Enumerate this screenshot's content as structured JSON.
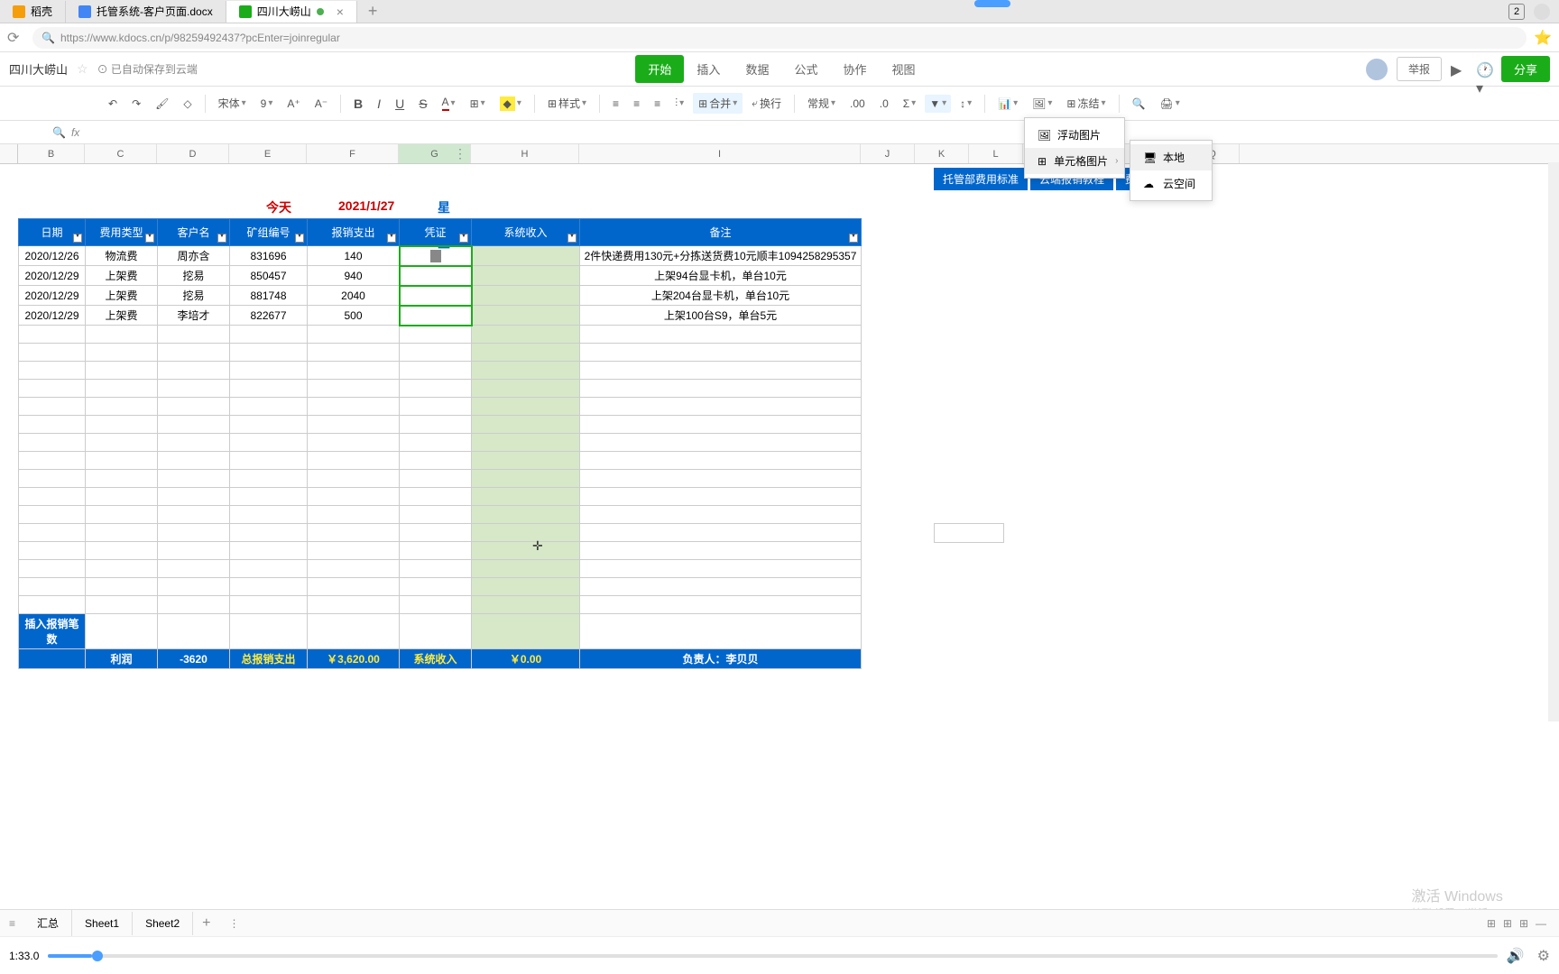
{
  "tabs": {
    "t1": "稻壳",
    "t2": "托管系统-客户页面.docx",
    "t3": "四川大崂山",
    "count": "2"
  },
  "url": "https://www.kdocs.cn/p/98259492437?pcEnter=joinregular",
  "doc": {
    "title": "四川大崂山",
    "save_status": "已自动保存到云端"
  },
  "menu": {
    "start": "开始",
    "insert": "插入",
    "data": "数据",
    "formula": "公式",
    "collab": "协作",
    "view": "视图",
    "report": "举报",
    "share": "分享"
  },
  "toolbar": {
    "font": "宋体",
    "size": "9",
    "style": "样式",
    "merge": "合并",
    "wrap": "换行",
    "format": "常规",
    "freeze": "冻结"
  },
  "columns": {
    "B": "B",
    "C": "C",
    "D": "D",
    "E": "E",
    "F": "F",
    "G": "G",
    "H": "H",
    "I": "I",
    "J": "J",
    "K": "K",
    "L": "L",
    "O": "O",
    "Q": "Q"
  },
  "links": {
    "l1": "托管部费用标准",
    "l2": "云端报销教程",
    "l3": "费用答"
  },
  "date_info": {
    "label": "今天是：",
    "value": "2021/1/27",
    "day": "星期三"
  },
  "headers": {
    "date": "日期",
    "type": "费用类型",
    "customer": "客户名",
    "mine": "矿组编号",
    "expense": "报销支出",
    "voucher": "凭证",
    "income": "系统收入",
    "remark": "备注"
  },
  "rows": [
    {
      "date": "2020/12/26",
      "type": "物流费",
      "cust": "周亦含",
      "mine": "831696",
      "exp": "140",
      "remark": "2件快递费用130元+分拣送货费10元顺丰1094258295357"
    },
    {
      "date": "2020/12/29",
      "type": "上架费",
      "cust": "挖易",
      "mine": "850457",
      "exp": "940",
      "remark": "上架94台显卡机，单台10元"
    },
    {
      "date": "2020/12/29",
      "type": "上架费",
      "cust": "挖易",
      "mine": "881748",
      "exp": "2040",
      "remark": "上架204台显卡机，单台10元"
    },
    {
      "date": "2020/12/29",
      "type": "上架费",
      "cust": "李培才",
      "mine": "822677",
      "exp": "500",
      "remark": "上架100台S9，单台5元"
    }
  ],
  "footer": {
    "insert": "插入报销笔数",
    "profit": "利润",
    "profit_val": "-3620",
    "total_label": "总报销支出",
    "total_val": "￥3,620.00",
    "income_label": "系统收入",
    "income_val": "￥0.00",
    "owner": "负责人：李贝贝"
  },
  "ctx_menu1": {
    "float_img": "浮动图片",
    "cell_img": "单元格图片"
  },
  "ctx_menu2": {
    "local": "本地",
    "cloud": "云空间"
  },
  "sheets": {
    "s0": "汇总",
    "s1": "Sheet1",
    "s2": "Sheet2"
  },
  "video": {
    "time": "1:33.0"
  },
  "watermark": {
    "l1": "激活 Windows",
    "l2": "转到\"设置\"以激活 Windows。"
  }
}
